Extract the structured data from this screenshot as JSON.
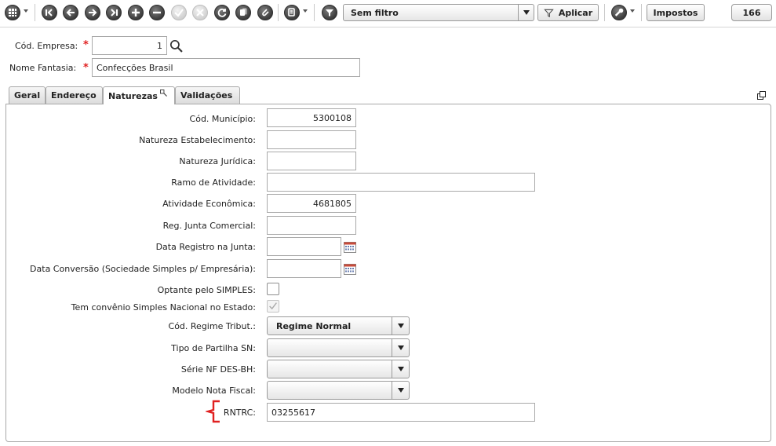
{
  "toolbar": {
    "icons": [
      "grid-menu-icon",
      "first-record-icon",
      "previous-record-icon",
      "next-record-icon",
      "last-record-icon",
      "add-icon",
      "remove-icon",
      "confirm-icon",
      "cancel-icon",
      "refresh-icon",
      "copy-icon",
      "attach-icon",
      "search-record-icon",
      "filter-icon",
      "tools-icon"
    ],
    "filter_value": "Sem filtro",
    "apply_label": "Aplicar",
    "taxes_label": "Impostos",
    "record_count": "166"
  },
  "header": {
    "company_code_label": "Cód. Empresa:",
    "company_code_value": "1",
    "trade_name_label": "Nome Fantasia:",
    "trade_name_value": "Confecções Brasil",
    "required_mark": "*"
  },
  "tabs": [
    {
      "label": "Geral"
    },
    {
      "label": "Endereço"
    },
    {
      "label": "Naturezas"
    },
    {
      "label": "Validações"
    }
  ],
  "form": {
    "municipio_label": "Cód. Município:",
    "municipio_value": "5300108",
    "nat_estab_label": "Natureza Estabelecimento:",
    "nat_estab_value": "",
    "nat_jur_label": "Natureza Jurídica:",
    "nat_jur_value": "",
    "ramo_label": "Ramo de Atividade:",
    "ramo_value": "",
    "ativ_econ_label": "Atividade Econômica:",
    "ativ_econ_value": "4681805",
    "reg_junta_label": "Reg. Junta Comercial:",
    "reg_junta_value": "",
    "data_reg_label": "Data Registro na Junta:",
    "data_reg_value": "",
    "data_conv_label": "Data Conversão (Sociedade Simples p/ Empresária):",
    "data_conv_value": "",
    "simples_label": "Optante pelo SIMPLES:",
    "simples_checked": false,
    "convenio_label": "Tem convênio Simples Nacional no Estado:",
    "convenio_checked": true,
    "regime_label": "Cód. Regime Tribut.:",
    "regime_value": "Regime Normal",
    "partilha_label": "Tipo de Partilha SN:",
    "partilha_value": "",
    "serie_label": "Série NF DES-BH:",
    "serie_value": "",
    "modelo_label": "Modelo Nota Fiscal:",
    "modelo_value": "",
    "rntrc_label": "RNTRC:",
    "rntrc_value": "03255617"
  },
  "colors": {
    "required": "#e02020",
    "highlight_bracket": "#e02020"
  }
}
